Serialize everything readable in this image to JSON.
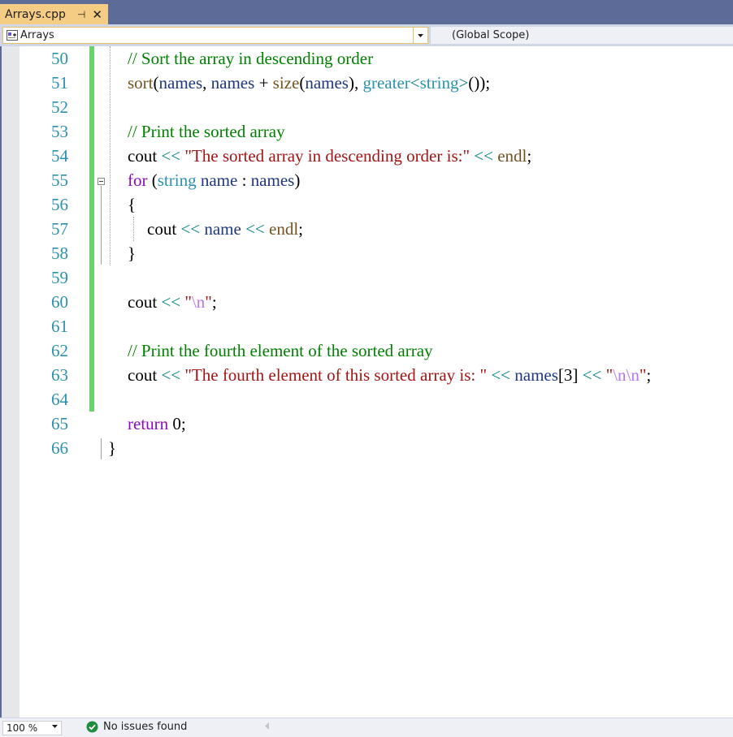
{
  "tab": {
    "title": "Arrays.cpp",
    "pin_glyph": "⊣",
    "close_glyph": "✕"
  },
  "navbar": {
    "project": "Arrays",
    "scope": "(Global Scope)"
  },
  "editor": {
    "lines": [
      {
        "num": "50",
        "indent": false,
        "tokens": [
          {
            "t": "// Sort the array in descending order",
            "c": "cmt"
          }
        ]
      },
      {
        "num": "51",
        "indent": false,
        "tokens": [
          {
            "t": "sort",
            "c": "fn"
          },
          {
            "t": "(",
            "c": "plain"
          },
          {
            "t": "names",
            "c": "id"
          },
          {
            "t": ", ",
            "c": "plain"
          },
          {
            "t": "names",
            "c": "id"
          },
          {
            "t": " + ",
            "c": "plain"
          },
          {
            "t": "size",
            "c": "fn"
          },
          {
            "t": "(",
            "c": "plain"
          },
          {
            "t": "names",
            "c": "id"
          },
          {
            "t": "), ",
            "c": "plain"
          },
          {
            "t": "greater",
            "c": "type"
          },
          {
            "t": "<",
            "c": "op"
          },
          {
            "t": "string",
            "c": "type"
          },
          {
            "t": ">",
            "c": "op"
          },
          {
            "t": "());",
            "c": "plain"
          }
        ]
      },
      {
        "num": "52",
        "indent": false,
        "tokens": []
      },
      {
        "num": "53",
        "indent": false,
        "tokens": [
          {
            "t": "// Print the sorted array",
            "c": "cmt"
          }
        ]
      },
      {
        "num": "54",
        "indent": false,
        "tokens": [
          {
            "t": "cout",
            "c": "plain"
          },
          {
            "t": " << ",
            "c": "op"
          },
          {
            "t": "\"The sorted array in descending order is:\"",
            "c": "str"
          },
          {
            "t": " << ",
            "c": "op"
          },
          {
            "t": "endl",
            "c": "fn"
          },
          {
            "t": ";",
            "c": "plain"
          }
        ]
      },
      {
        "num": "55",
        "indent": false,
        "tokens": [
          {
            "t": "for",
            "c": "kw"
          },
          {
            "t": " (",
            "c": "plain"
          },
          {
            "t": "string",
            "c": "type"
          },
          {
            "t": " ",
            "c": "plain"
          },
          {
            "t": "name",
            "c": "id"
          },
          {
            "t": " : ",
            "c": "plain"
          },
          {
            "t": "names",
            "c": "id"
          },
          {
            "t": ")",
            "c": "plain"
          }
        ]
      },
      {
        "num": "56",
        "indent": false,
        "tokens": [
          {
            "t": "{",
            "c": "plain"
          }
        ]
      },
      {
        "num": "57",
        "indent": true,
        "tokens": [
          {
            "t": "cout",
            "c": "plain"
          },
          {
            "t": " << ",
            "c": "op"
          },
          {
            "t": "name",
            "c": "id"
          },
          {
            "t": " << ",
            "c": "op"
          },
          {
            "t": "endl",
            "c": "fn"
          },
          {
            "t": ";",
            "c": "plain"
          }
        ]
      },
      {
        "num": "58",
        "indent": false,
        "tokens": [
          {
            "t": "}",
            "c": "plain"
          }
        ]
      },
      {
        "num": "59",
        "indent": false,
        "tokens": []
      },
      {
        "num": "60",
        "indent": false,
        "tokens": [
          {
            "t": "cout",
            "c": "plain"
          },
          {
            "t": " << ",
            "c": "op"
          },
          {
            "t": "\"",
            "c": "str"
          },
          {
            "t": "\\n",
            "c": "esc"
          },
          {
            "t": "\"",
            "c": "str"
          },
          {
            "t": ";",
            "c": "plain"
          }
        ]
      },
      {
        "num": "61",
        "indent": false,
        "tokens": []
      },
      {
        "num": "62",
        "indent": false,
        "tokens": [
          {
            "t": "// Print the fourth element of the sorted array",
            "c": "cmt"
          }
        ]
      },
      {
        "num": "63",
        "indent": false,
        "tokens": [
          {
            "t": "cout",
            "c": "plain"
          },
          {
            "t": " << ",
            "c": "op"
          },
          {
            "t": "\"The fourth element of this sorted array is: \"",
            "c": "str"
          },
          {
            "t": " << ",
            "c": "op"
          },
          {
            "t": "names",
            "c": "id"
          },
          {
            "t": "[3]",
            "c": "plain"
          },
          {
            "t": " << ",
            "c": "op"
          },
          {
            "t": "\"",
            "c": "str"
          },
          {
            "t": "\\n\\n",
            "c": "esc"
          },
          {
            "t": "\"",
            "c": "str"
          },
          {
            "t": ";",
            "c": "plain"
          }
        ]
      },
      {
        "num": "64",
        "indent": false,
        "tokens": []
      },
      {
        "num": "65",
        "indent": false,
        "tokens": [
          {
            "t": "return",
            "c": "kw"
          },
          {
            "t": " 0;",
            "c": "plain"
          }
        ]
      },
      {
        "num": "66",
        "indent": false,
        "outer": true,
        "tokens": [
          {
            "t": "}",
            "c": "plain"
          }
        ]
      }
    ]
  },
  "statusbar": {
    "zoom": "100 %",
    "issues": "No issues found"
  },
  "colors": {
    "accent_tab": "#f5cc84",
    "change_bar": "#6cd36c",
    "line_number": "#2b91af",
    "ok_icon": "#1e8e3e"
  },
  "icons": {
    "tab_pin": "pin-icon",
    "tab_close": "close-icon",
    "nav_file": "cpp-file-icon",
    "ok": "check-circle-icon"
  }
}
